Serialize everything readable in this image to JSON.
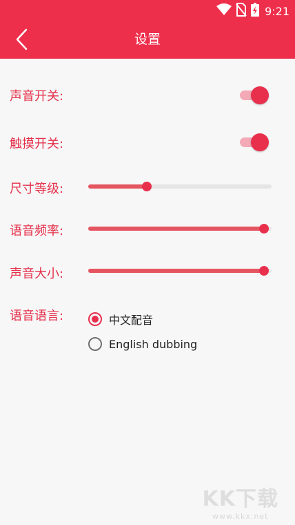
{
  "status_bar": {
    "time": "9:21",
    "icons": [
      "wifi-icon",
      "no-sim-icon",
      "battery-charging-icon"
    ]
  },
  "app_bar": {
    "title": "设置",
    "back_icon": "chevron-left-icon"
  },
  "colors": {
    "primary": "#ee2f4c",
    "label": "#e5304b",
    "track": "#e5e5e5"
  },
  "settings": {
    "sound_switch": {
      "label": "声音开关:",
      "on": true
    },
    "touch_switch": {
      "label": "触摸开关:",
      "on": true
    },
    "size_level": {
      "label": "尺寸等级:",
      "value": 0.32
    },
    "voice_rate": {
      "label": "语音频率:",
      "value": 0.96
    },
    "volume": {
      "label": "声音大小:",
      "value": 0.96
    },
    "voice_language": {
      "label": "语音语言:",
      "options": [
        {
          "label": "中文配音",
          "selected": true
        },
        {
          "label": "English dubbing",
          "selected": false
        }
      ]
    }
  },
  "watermark": {
    "logo": "KK下载",
    "url": "www.kkx.net"
  }
}
